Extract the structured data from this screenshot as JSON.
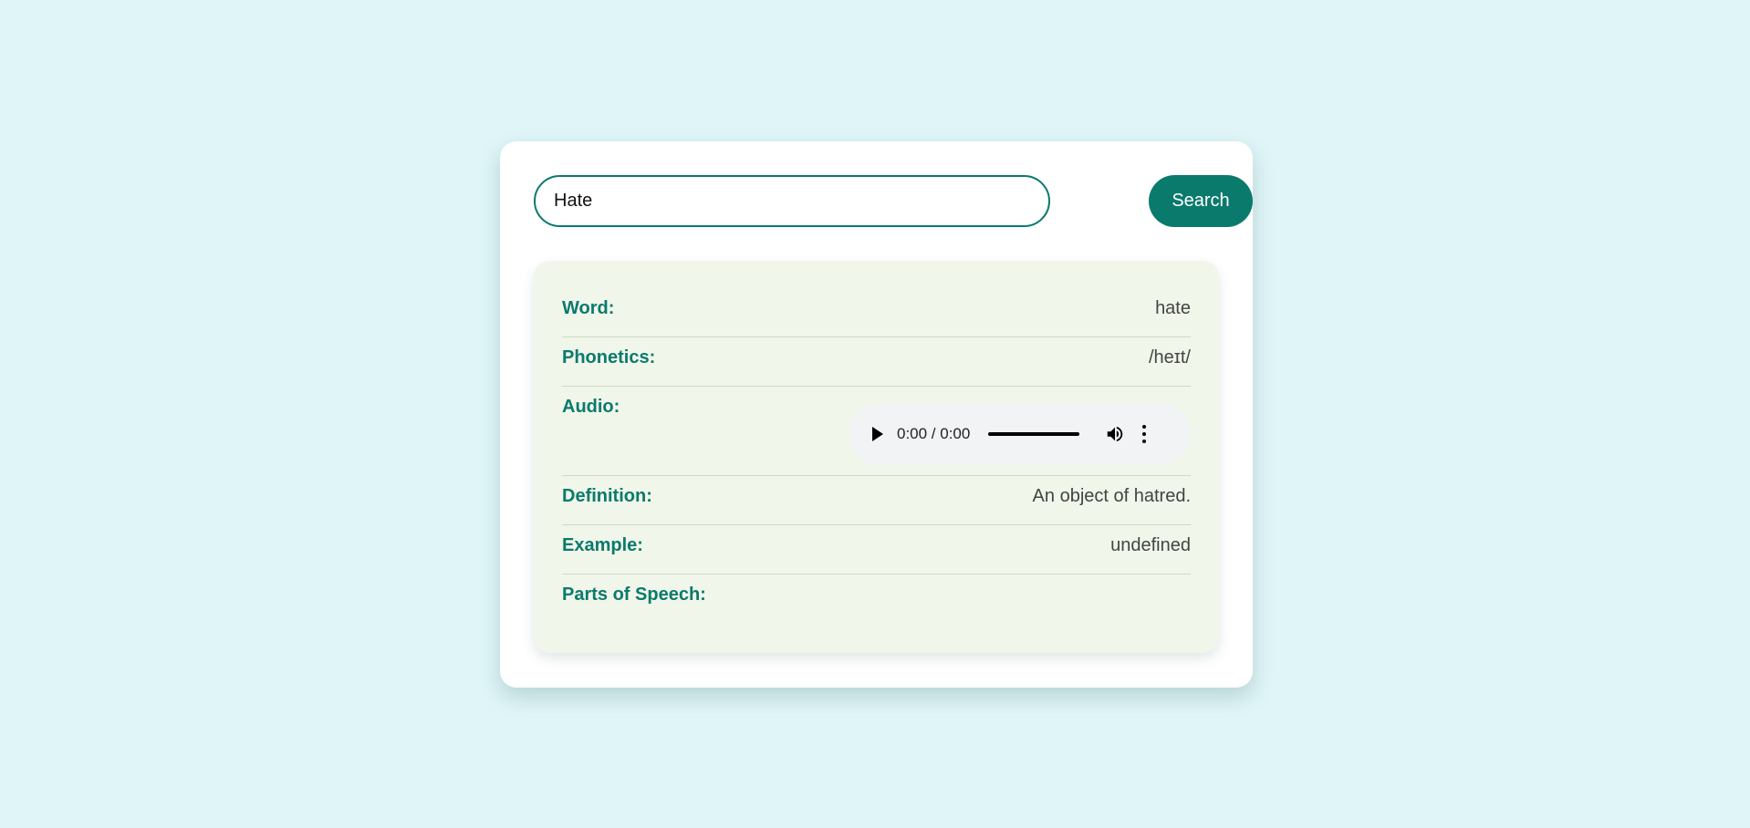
{
  "search": {
    "value": "Hate",
    "button_label": "Search"
  },
  "result": {
    "word": {
      "label": "Word:",
      "value": "hate"
    },
    "phonetics": {
      "label": "Phonetics:",
      "value": "/heɪt/"
    },
    "audio": {
      "label": "Audio:",
      "time": "0:00 / 0:00",
      "progress": 0
    },
    "definition": {
      "label": "Definition:",
      "value": "An object of hatred."
    },
    "example": {
      "label": "Example:",
      "value": "undefined"
    },
    "parts_of_speech": {
      "label": "Parts of Speech:",
      "value": ""
    }
  },
  "colors": {
    "accent": "#0a7a6d",
    "page_background": "#dff5f7",
    "panel_background": "#f0f6e9"
  },
  "icons": {
    "play": "play-icon",
    "volume": "volume-icon",
    "more": "more-vertical-icon"
  }
}
